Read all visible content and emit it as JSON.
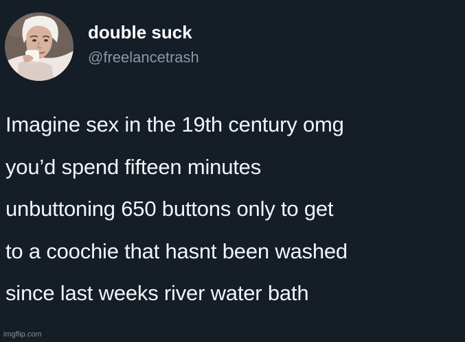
{
  "user": {
    "display_name": "double suck",
    "handle": "@freelancetrash",
    "avatar_icon": "profile-photo-avatar"
  },
  "tweet": {
    "lines": [
      "Imagine sex in the 19th century omg",
      "you’d spend fifteen minutes",
      "unbuttoning 650 buttons only to get",
      "to a coochie that hasnt been washed",
      "since last weeks river water bath"
    ]
  },
  "watermark": "imgflip.com",
  "colors": {
    "background": "#151d27",
    "text": "#f2f4f7",
    "handle": "#8899a6"
  }
}
